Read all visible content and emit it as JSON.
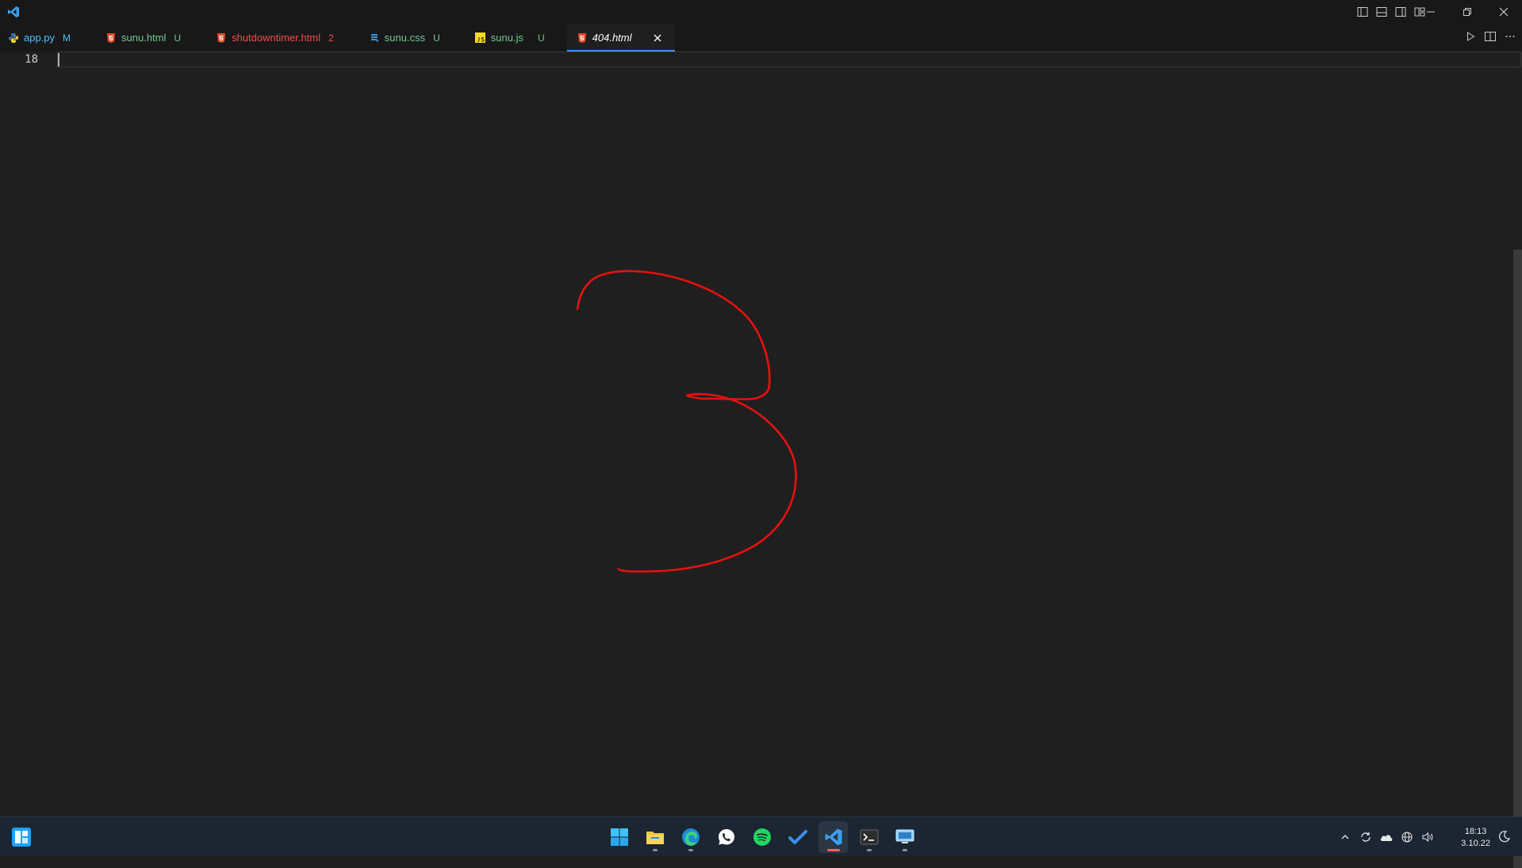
{
  "tabs": [
    {
      "label": "app.py",
      "status": "M",
      "icon": "python-icon",
      "color": "#4fc1ff",
      "status_color": "#4fc1ff"
    },
    {
      "label": "sunu.html",
      "status": "U",
      "icon": "html5-icon",
      "color": "#73c991",
      "status_color": "#73c991"
    },
    {
      "label": "shutdowntimer.html",
      "status": "2",
      "icon": "html5-icon",
      "color": "#f14c4c",
      "status_color": "#f14c4c"
    },
    {
      "label": "sunu.css",
      "status": "U",
      "icon": "css-icon",
      "color": "#73c991",
      "status_color": "#73c991"
    },
    {
      "label": "sunu.js",
      "status": "U",
      "icon": "js-icon",
      "color": "#73c991",
      "status_color": "#73c991"
    },
    {
      "label": "404.html",
      "status": "",
      "icon": "html5-icon",
      "color": "#ffffff",
      "active": true
    }
  ],
  "editor": {
    "line_number": "18"
  },
  "annotation": {
    "shape": "digit-three-ink-stroke",
    "color": "#e81010"
  },
  "taskbar": {
    "apps": [
      "start-icon",
      "file-explorer-icon",
      "edge-icon",
      "whatsapp-icon",
      "spotify-icon",
      "todo-icon",
      "vscode-icon",
      "terminal-icon",
      "remote-desktop-icon"
    ],
    "active_app": "vscode-icon"
  },
  "clock": {
    "time": "18:13",
    "date": "3.10.22"
  }
}
